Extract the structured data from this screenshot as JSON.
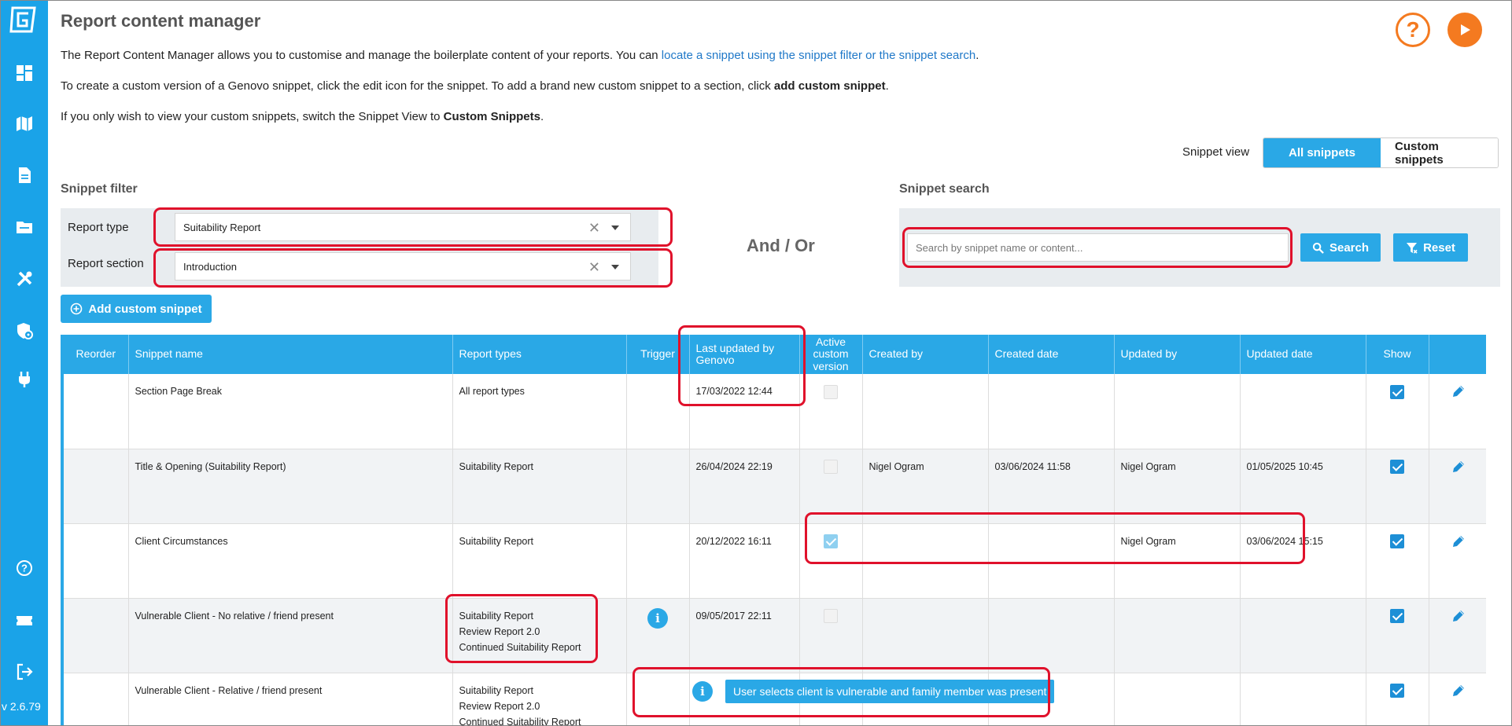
{
  "app": {
    "title": "Report content manager",
    "version": "v 2.6.79"
  },
  "sidebar": {
    "items": [
      {
        "icon": "dashboard-icon"
      },
      {
        "icon": "map-icon"
      },
      {
        "icon": "document-icon"
      },
      {
        "icon": "folder-icon"
      },
      {
        "icon": "tools-icon"
      },
      {
        "icon": "shield-settings-icon"
      },
      {
        "icon": "plug-icon"
      }
    ],
    "bottom": [
      {
        "icon": "help-icon"
      },
      {
        "icon": "ticket-icon"
      },
      {
        "icon": "logout-icon"
      }
    ]
  },
  "intro": {
    "line1_pre": "The Report Content Manager allows you to customise and manage the boilerplate content of your reports. You can ",
    "line1_link": "locate a snippet using the snippet filter or the snippet search",
    "line1_post": ".",
    "line2_pre": "To create a custom version of a Genovo snippet, click the edit icon for the snippet. To add a brand new custom snippet to a section, click ",
    "line2_bold": "add custom snippet",
    "line2_post": ".",
    "line3_pre": "If you only wish to view your custom snippets, switch the Snippet View to ",
    "line3_bold": "Custom Snippets",
    "line3_post": "."
  },
  "snippet_view": {
    "label": "Snippet view",
    "options": [
      "All snippets",
      "Custom snippets"
    ],
    "selected": "All snippets"
  },
  "filter": {
    "heading": "Snippet filter",
    "report_type_label": "Report type",
    "report_type_value": "Suitability Report",
    "report_section_label": "Report section",
    "report_section_value": "Introduction",
    "clear_glyph": "✕"
  },
  "andor": "And / Or",
  "search": {
    "heading": "Snippet search",
    "placeholder": "Search by snippet name or content...",
    "search_label": "Search",
    "reset_label": "Reset"
  },
  "add_button_label": "Add custom snippet",
  "table": {
    "headers": [
      "Reorder",
      "Snippet name",
      "Report types",
      "Trigger",
      "Last updated by Genovo",
      "Active custom version",
      "Created by",
      "Created date",
      "Updated by",
      "Updated date",
      "Show",
      ""
    ],
    "rows": [
      {
        "name": "Section Page Break",
        "report_types": [
          "All report types"
        ],
        "trigger": false,
        "last_updated": "17/03/2022 12:44",
        "active": "off",
        "created_by": "",
        "created_date": "",
        "updated_by": "",
        "updated_date": "",
        "show": true
      },
      {
        "name": "Title & Opening (Suitability Report)",
        "report_types": [
          "Suitability Report"
        ],
        "trigger": false,
        "last_updated": "26/04/2024 22:19",
        "active": "off",
        "created_by": "Nigel Ogram",
        "created_date": "03/06/2024 11:58",
        "updated_by": "Nigel Ogram",
        "updated_date": "01/05/2025 10:45",
        "show": true
      },
      {
        "name": "Client Circumstances",
        "report_types": [
          "Suitability Report"
        ],
        "trigger": false,
        "last_updated": "20/12/2022 16:11",
        "active": "light",
        "created_by": "",
        "created_date": "",
        "updated_by": "Nigel Ogram",
        "updated_date": "03/06/2024 15:15",
        "show": true
      },
      {
        "name": "Vulnerable Client - No relative / friend present",
        "report_types": [
          "Suitability Report",
          "Review Report 2.0",
          "Continued Suitability Report"
        ],
        "trigger": true,
        "last_updated": "09/05/2017 22:11",
        "active": "off",
        "created_by": "",
        "created_date": "",
        "updated_by": "",
        "updated_date": "",
        "show": true
      },
      {
        "name": "Vulnerable Client - Relative / friend present",
        "report_types": [
          "Suitability Report",
          "Review Report 2.0",
          "Continued Suitability Report"
        ],
        "trigger": false,
        "last_updated": "",
        "active": "none",
        "created_by": "",
        "created_date": "",
        "updated_by": "",
        "updated_date": "",
        "show": true
      }
    ]
  },
  "tooltip": {
    "text": "User selects client is vulnerable and family member was present"
  },
  "colors": {
    "sidebar": "#1aa3e8",
    "primary": "#2aa8e6",
    "accent_orange": "#f47a20",
    "highlight_red": "#e0112b"
  }
}
